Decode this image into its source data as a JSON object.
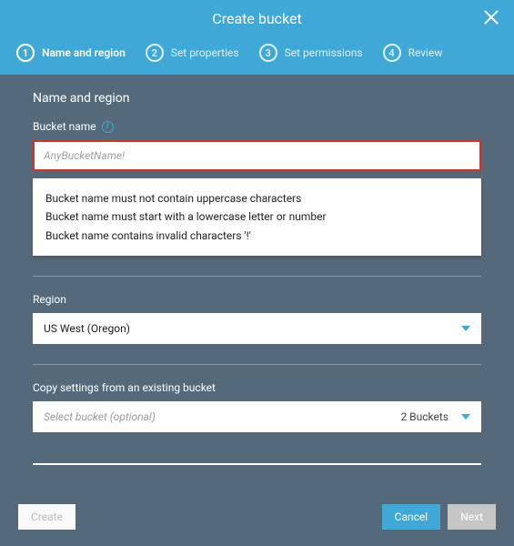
{
  "header": {
    "title": "Create bucket"
  },
  "steps": [
    {
      "num": "1",
      "label": "Name and region",
      "active": true
    },
    {
      "num": "2",
      "label": "Set properties"
    },
    {
      "num": "3",
      "label": "Set permissions"
    },
    {
      "num": "4",
      "label": "Review"
    }
  ],
  "section": {
    "title": "Name and region",
    "bucket_label": "Bucket name",
    "bucket_value": "AnyBucketName!",
    "errors": [
      "Bucket name must not contain uppercase characters",
      "Bucket name must start with a lowercase letter or number",
      "Bucket name contains invalid characters '!'"
    ],
    "region_label": "Region",
    "region_value": "US West (Oregon)",
    "copy_label": "Copy settings from an existing bucket",
    "copy_placeholder": "Select bucket (optional)",
    "copy_count": "2 Buckets"
  },
  "footer": {
    "create": "Create",
    "cancel": "Cancel",
    "next": "Next"
  }
}
